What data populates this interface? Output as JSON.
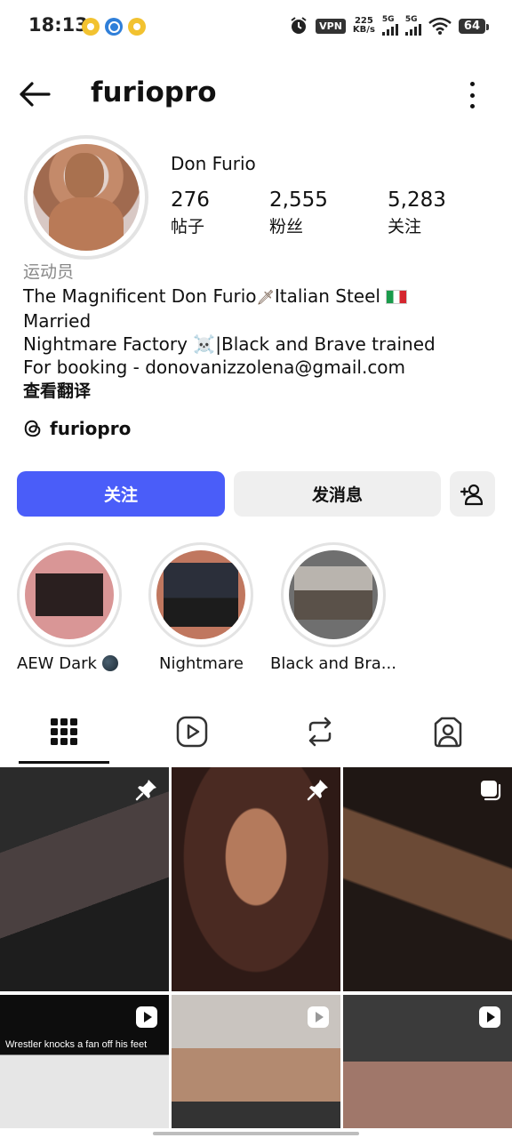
{
  "status_bar": {
    "time": "18:13",
    "vpn": "VPN",
    "net_speed_value": "225",
    "net_speed_unit": "KB/s",
    "signal1_label": "5G",
    "signal2_label": "5G",
    "battery": "64"
  },
  "header": {
    "username": "furiopro"
  },
  "profile": {
    "display_name": "Don Furio",
    "stats": [
      {
        "value": "276",
        "label": "帖子"
      },
      {
        "value": "2,555",
        "label": "粉丝"
      },
      {
        "value": "5,283",
        "label": "关注"
      }
    ],
    "category": "运动员",
    "bio_line1_a": "The Magnificent Don Furio",
    "bio_line1_b": "Italian Steel",
    "bio_line2": "Married",
    "bio_line3_a": "Nightmare Factory",
    "bio_line3_b": "|Black and Brave trained",
    "bio_line4": "For  booking - donovanizzolena@gmail.com",
    "translate_label": "查看翻译",
    "threads_handle": "furiopro"
  },
  "actions": {
    "follow_label": "关注",
    "message_label": "发消息"
  },
  "highlights": [
    {
      "label": "AEW Dark"
    },
    {
      "label": "Nightmare"
    },
    {
      "label": "Black and Bra..."
    }
  ],
  "posts": [
    {
      "caption": ""
    },
    {
      "caption": ""
    },
    {
      "caption": ""
    },
    {
      "caption": "Wrestler knocks a fan off his feet"
    },
    {
      "caption": ""
    },
    {
      "caption": ""
    }
  ],
  "colors": {
    "follow_button": "#4a5df9",
    "secondary_button": "#efefef"
  }
}
